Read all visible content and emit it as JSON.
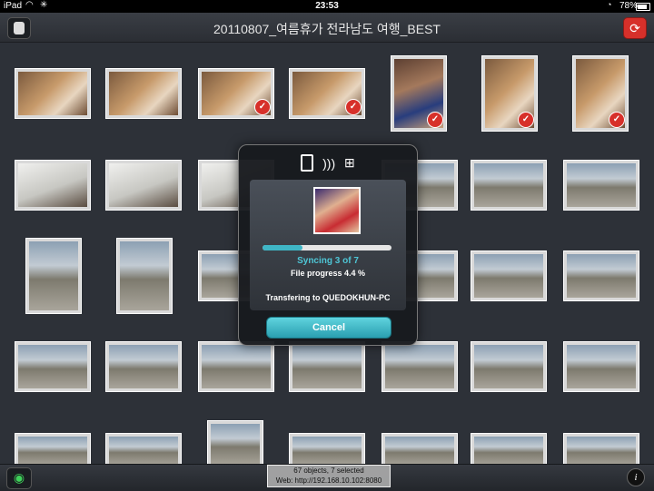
{
  "status_bar": {
    "carrier": "iPad",
    "time": "23:53",
    "battery": "78%"
  },
  "header": {
    "title": "20110807_여름휴가 전라남도 여행_BEST"
  },
  "sync_dialog": {
    "syncing": "Syncing 3 of 7",
    "file_progress": "File progress 4.4 %",
    "transfer_to": "Transfering to QUEDOKHUN-PC",
    "cancel_label": "Cancel",
    "progress_fraction": 0.31
  },
  "footer": {
    "objects_summary": "67 objects, 7 selected",
    "web_address": "Web: http://192.168.10.102:8080"
  },
  "icons": {
    "wifi": "wifi-icon",
    "activity": "activity-spinner-icon",
    "lock": "rotation-lock-icon",
    "battery": "battery-icon",
    "database": "database-icon",
    "sync": "sync-arrows-icon",
    "tablet": "tablet-icon",
    "wireless": "wireless-waves-icon",
    "windows": "windows-logo-icon",
    "eye": "eye-icon",
    "info": "info-icon",
    "check": "checkmark-icon"
  },
  "colors": {
    "accent": "#3fb6c6",
    "selected_check": "#d7302a",
    "background": "#2d3138"
  }
}
